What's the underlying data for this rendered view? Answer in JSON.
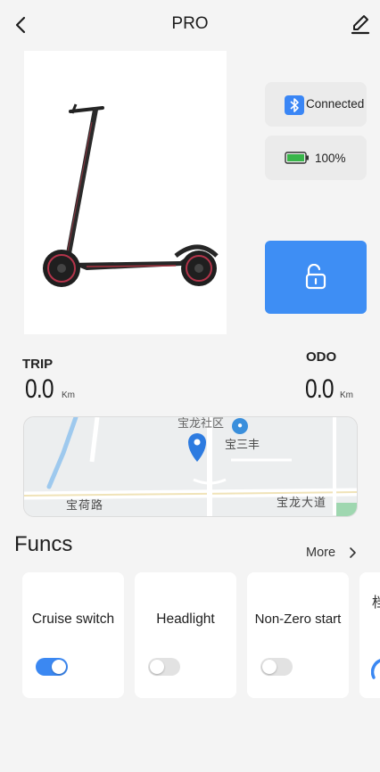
{
  "header": {
    "title": "PRO",
    "back_icon": "chevron-left-icon",
    "edit_icon": "pencil-icon"
  },
  "device": {
    "image": "electric-scooter-image",
    "connection_status": "Connected",
    "connection_icon": "bluetooth-icon",
    "battery_level": "100%",
    "battery_icon": "battery-icon",
    "lock_icon": "unlock-icon",
    "lock_color": "#3e8ef4"
  },
  "stats": {
    "trip_label": "TRIP",
    "trip_value": "0.0",
    "trip_unit": "Km",
    "odo_label": "ODO",
    "odo_value": "0.0",
    "odo_unit": "Km"
  },
  "map": {
    "top_label": "宝龙社区",
    "poi_label": "宝三丰",
    "road_left": "宝荷路",
    "road_right": "宝龙大道",
    "marker_icon": "location-pin-icon"
  },
  "funcs": {
    "title": "Funcs",
    "more_label": "More",
    "items": [
      {
        "label": "Cruise switch",
        "enabled": true
      },
      {
        "label": "Headlight",
        "enabled": false
      },
      {
        "label": "Non-Zero start",
        "enabled": false
      },
      {
        "label": "档"
      }
    ]
  },
  "colors": {
    "accent": "#3b88f2",
    "background": "#f4f4f4",
    "card": "#ffffff"
  }
}
